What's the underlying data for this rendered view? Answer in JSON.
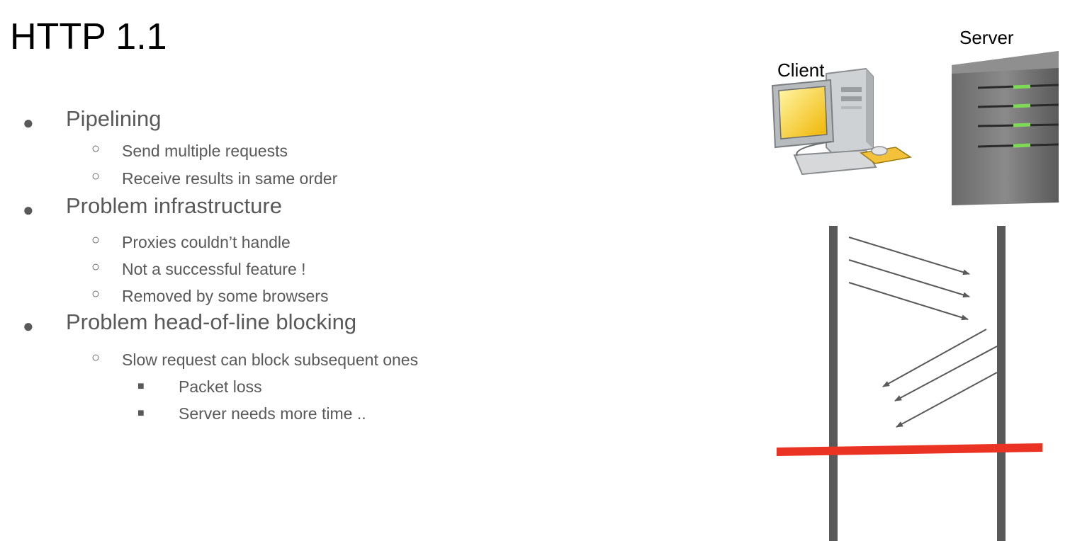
{
  "slide": {
    "title": "HTTP 1.1",
    "bullets": {
      "pipelining": "Pipelining",
      "send_multiple": "Send multiple requests",
      "receive_same_order": "Receive results in same order",
      "problem_infra": "Problem infrastructure",
      "proxies": "Proxies couldn’t handle",
      "not_successful": "Not a successful feature !",
      "removed": "Removed by some browsers",
      "problem_hol": "Problem head-of-line blocking",
      "slow_request": "Slow request can block subsequent ones",
      "packet_loss": "Packet loss",
      "server_time": "Server needs more time .."
    }
  },
  "diagram": {
    "client_label": "Client",
    "server_label": "Server",
    "colors": {
      "lifeline": "#595959",
      "arrow": "#595959",
      "block_line": "#ea3323",
      "led": "#7ed957"
    }
  }
}
